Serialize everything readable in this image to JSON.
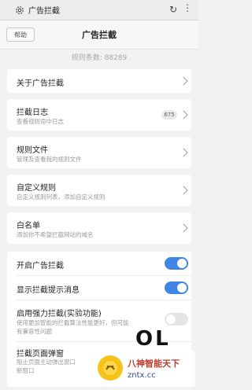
{
  "topbar": {
    "title": "广告拦截",
    "refresh_icon": "refresh-icon",
    "more_icon": "more-vertical-icon"
  },
  "header": {
    "help_label": "帮助",
    "title": "广告拦截"
  },
  "rule_count": "规则条数: 88289",
  "items": {
    "about": {
      "label": "关于广告拦截"
    },
    "log": {
      "label": "拦截日志",
      "sub": "查看规则命中日志",
      "badge": "675"
    },
    "rules_file": {
      "label": "规则文件",
      "sub": "管理及查看我的规则文件"
    },
    "custom_rules": {
      "label": "自定义规则",
      "sub": "自定义规则列表，添加自定义规则"
    },
    "whitelist": {
      "label": "白名单",
      "sub": "添加你不希望拦截网站的域名"
    }
  },
  "toggles": {
    "enable": {
      "label": "开启广告拦截",
      "on": true
    },
    "show_msg": {
      "label": "显示拦截提示消息",
      "on": true
    },
    "strong": {
      "label": "启用强力拦截(实验功能)",
      "sub1": "使用更加智能的拦截算法性能更好，但可能",
      "sub2": "有兼容性问题",
      "on": false
    },
    "popup": {
      "label": "拦截页面弹窗",
      "sub1": "阻止页面主动弹出窗口",
      "sub2": "新窗口"
    }
  },
  "overlay": {
    "big_text": "OL",
    "wm_text": "八神智能天下",
    "wm_url": "zntx.cc"
  },
  "colors": {
    "accent": "#3f86e6",
    "background": "#f2f2f2",
    "card": "#ffffff"
  }
}
